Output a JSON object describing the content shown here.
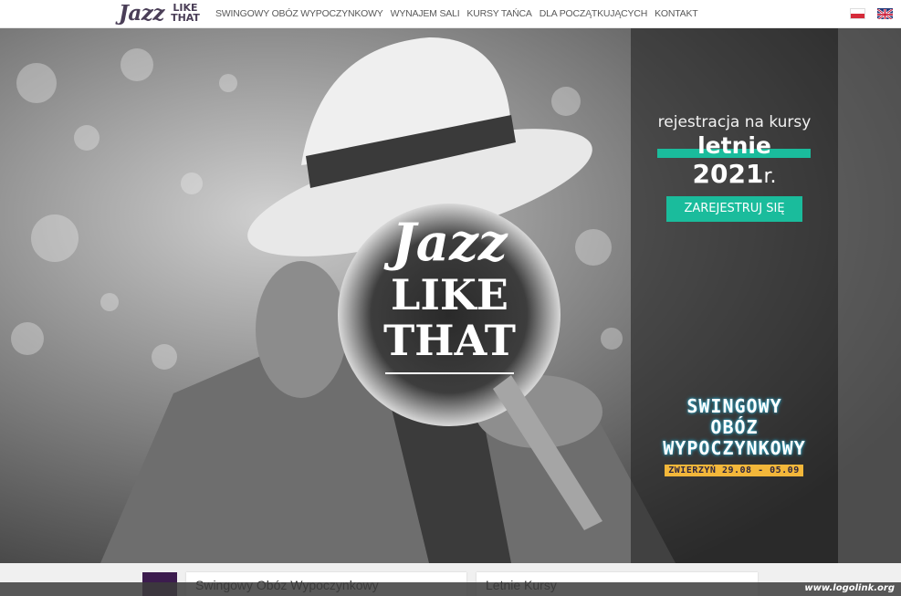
{
  "nav": {
    "logo": {
      "word1": "Jazz",
      "word2_line1": "LIKE",
      "word2_line2": "THAT"
    },
    "menu": [
      {
        "label": "SWINGOWY OBÓZ WYPOCZYNKOWY"
      },
      {
        "label": "WYNAJEM SALI"
      },
      {
        "label": "KURSY TAŃCA"
      },
      {
        "label": "DLA POCZĄTKUJĄCYCH"
      },
      {
        "label": "KONTAKT"
      }
    ],
    "languages": [
      {
        "code": "pl",
        "icon": "flag-pl-icon"
      },
      {
        "code": "en",
        "icon": "flag-uk-icon"
      }
    ]
  },
  "hero": {
    "center_logo": {
      "line1": "Jazz",
      "line2": "LIKE",
      "line3": "THAT"
    },
    "registration": {
      "title": "rejestracja na kursy",
      "season": "letnie",
      "year": "2021",
      "year_suffix": "r.",
      "button_label": "ZAREJESTRUJ SIĘ"
    },
    "camp": {
      "line1": "SWINGOWY",
      "line2": "OBÓZ",
      "line3": "WYPOCZYNKOWY",
      "date_badge": "ZWIERZYŃ 29.08 - 05.09"
    }
  },
  "cards": [
    {
      "title": "Swingowy Obóz Wypoczynkowy"
    },
    {
      "title": "Letnie Kursy"
    }
  ],
  "watermark": "www.logolink.org",
  "colors": {
    "accent": "#1abc9c",
    "brand": "#4a3e57",
    "badge": "#f3b73a",
    "dark_purple": "#3c1c4e"
  }
}
